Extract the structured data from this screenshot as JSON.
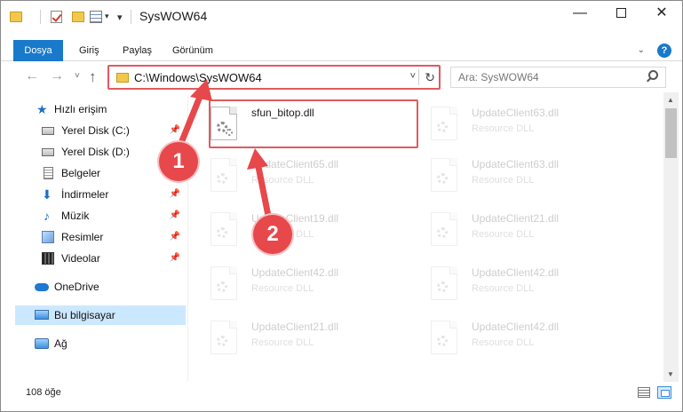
{
  "window": {
    "title": "SysWOW64",
    "minimize": "—",
    "close": "✕"
  },
  "ribbon": {
    "tabs": [
      {
        "label": "Dosya"
      },
      {
        "label": "Giriş"
      },
      {
        "label": "Paylaş"
      },
      {
        "label": "Görünüm"
      }
    ],
    "help": "?"
  },
  "nav": {
    "back": "←",
    "forward": "→",
    "history": "˅",
    "up": "↑",
    "address": "C:\\Windows\\SysWOW64",
    "address_dropdown": "˅",
    "refresh": "↻",
    "search_placeholder": "Ara: SysWOW64"
  },
  "sidebar": {
    "items": [
      {
        "label": "Hızlı erişim",
        "icon": "star-icon",
        "pinned": false
      },
      {
        "label": "Yerel Disk (C:)",
        "icon": "drive-icon",
        "pinned": true
      },
      {
        "label": "Yerel Disk (D:)",
        "icon": "drive-icon",
        "pinned": false
      },
      {
        "label": "Belgeler",
        "icon": "documents-icon",
        "pinned": false
      },
      {
        "label": "İndirmeler",
        "icon": "download-icon",
        "pinned": true
      },
      {
        "label": "Müzik",
        "icon": "music-icon",
        "pinned": true
      },
      {
        "label": "Resimler",
        "icon": "pictures-icon",
        "pinned": true
      },
      {
        "label": "Videolar",
        "icon": "video-icon",
        "pinned": true
      },
      {
        "label": "OneDrive",
        "icon": "onedrive-icon",
        "pinned": false
      },
      {
        "label": "Bu bilgisayar",
        "icon": "computer-icon",
        "pinned": false,
        "selected": true
      },
      {
        "label": "Ağ",
        "icon": "network-icon",
        "pinned": false
      }
    ],
    "pin_glyph": "📌"
  },
  "files": {
    "highlighted": {
      "name": "sfun_bitop.dll",
      "desc": ""
    },
    "items": [
      {
        "name": "UpdateClient63.dll",
        "desc": "Resource DLL"
      },
      {
        "name": "UpdateClient65.dll",
        "desc": "Resource DLL"
      },
      {
        "name": "UpdateClient63.dll",
        "desc": "Resource DLL"
      },
      {
        "name": "UpdateClient19.dll",
        "desc": "Resource DLL"
      },
      {
        "name": "UpdateClient21.dll",
        "desc": "Resource DLL"
      },
      {
        "name": "UpdateClient42.dll",
        "desc": "Resource DLL"
      },
      {
        "name": "UpdateClient42.dll",
        "desc": "Resource DLL"
      },
      {
        "name": "UpdateClient21.dll",
        "desc": "Resource DLL"
      },
      {
        "name": "UpdateClient42.dll",
        "desc": "Resource DLL"
      }
    ]
  },
  "annotations": {
    "step1": "1",
    "step2": "2",
    "color": "#e7484b"
  },
  "status": {
    "count": "108 öğe"
  },
  "colors": {
    "accent": "#1979ca",
    "highlight_border": "#e05a5e",
    "selected_bg": "#cce8ff"
  }
}
